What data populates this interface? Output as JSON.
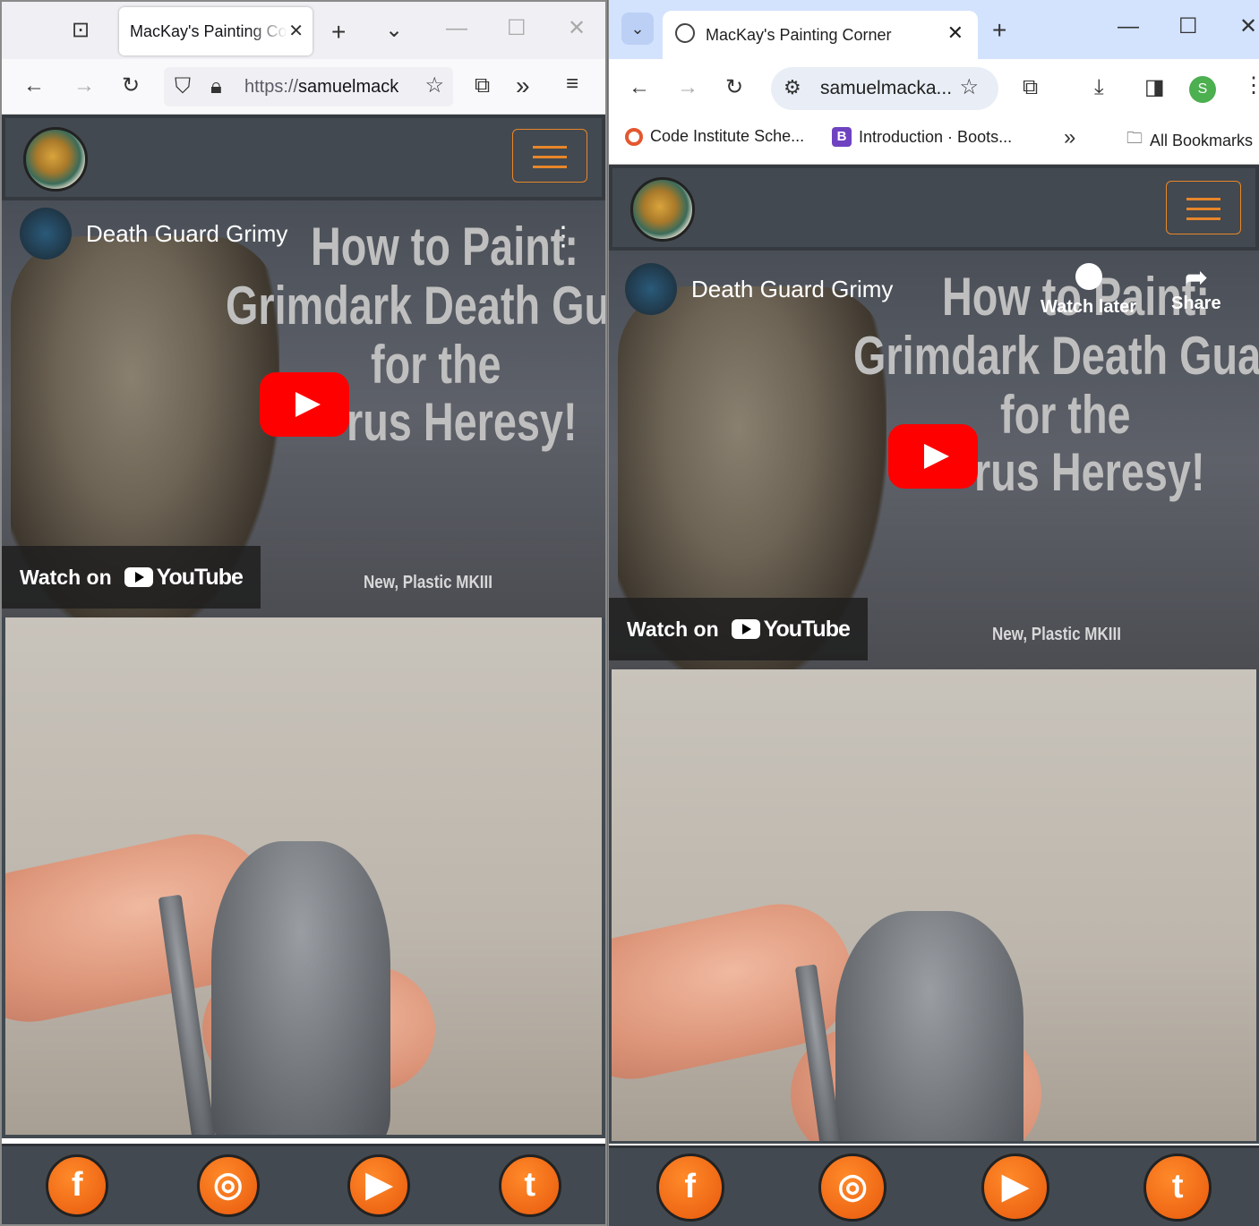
{
  "firefox": {
    "tab_title": "MacKay's Painting Co",
    "url_prefix": "https://",
    "url_host": "samuelmack"
  },
  "chrome": {
    "tab_title": "MacKay's Painting Corner",
    "url": "samuelmacka...",
    "profile_initial": "S",
    "bookmarks": [
      "Code Institute Sche...",
      "Introduction · Boots...",
      "All Bookmarks"
    ]
  },
  "site": {
    "video": {
      "channel": "Death Guard Grimy",
      "title_lines": [
        "How to Paint:",
        "Grimdark Death Guard",
        "for the",
        "rus Heresy!"
      ],
      "subtitle": "New, Plastic MKIII",
      "watch_on": "Watch on",
      "youtube": "YouTube",
      "watch_later": "Watch later",
      "share": "Share"
    },
    "social": [
      "f",
      "◎",
      "▶",
      "t"
    ],
    "accent": "#e8862a"
  }
}
